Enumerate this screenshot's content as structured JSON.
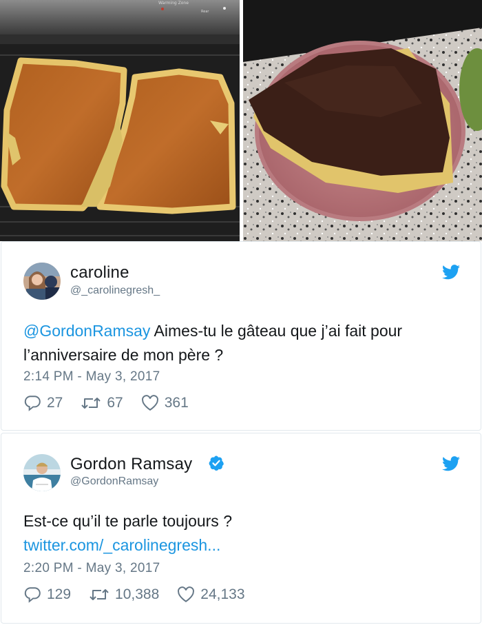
{
  "colors": {
    "link": "#1b95e0",
    "meta": "#657786",
    "text": "#14171a",
    "twitter_blue": "#1da1f2",
    "border": "#e1e8ed"
  },
  "photos": {
    "left_stove_text_1": "Warming Zone",
    "left_stove_text_2": "Rear"
  },
  "tweets": [
    {
      "name": "caroline",
      "handle": "@_carolinegresh_",
      "verified": false,
      "mention": "@GordonRamsay",
      "text": " Aimes-tu le gâteau que j’ai fait pour l’anniversaire de mon père ?",
      "link": "",
      "timestamp": "2:14 PM - May 3, 2017",
      "replies": "27",
      "retweets": "67",
      "likes": "361",
      "icons": [
        "reply-icon",
        "retweet-icon",
        "heart-icon",
        "twitter-bird-icon"
      ]
    },
    {
      "name": "Gordon Ramsay",
      "handle": "@GordonRamsay",
      "verified": true,
      "mention": "",
      "text": "Est-ce qu’il te parle toujours ?",
      "link": "twitter.com/_carolinegresh...",
      "timestamp": "2:20 PM - May 3, 2017",
      "replies": "129",
      "retweets": "10,388",
      "likes": "24,133",
      "icons": [
        "reply-icon",
        "retweet-icon",
        "heart-icon",
        "twitter-bird-icon",
        "verified-badge-icon"
      ]
    }
  ]
}
